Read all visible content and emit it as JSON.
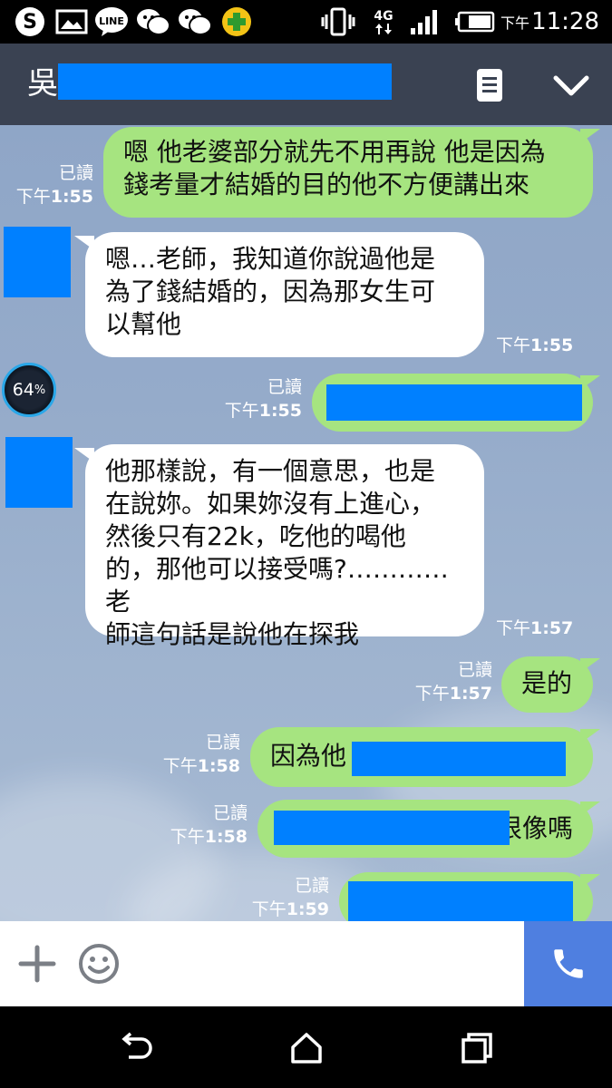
{
  "status_bar": {
    "network": "4G",
    "time_prefix": "下午",
    "time": "11:28",
    "icons": [
      "skype-icon",
      "gallery-icon",
      "line-icon",
      "wechat-icon",
      "wechat-icon",
      "plus-app-icon",
      "vibrate-icon",
      "signal-icon",
      "battery-icon"
    ]
  },
  "header": {
    "contact_name": "吳"
  },
  "messages": [
    {
      "dir": "out",
      "text": "嗯 他老婆部分就先不用再說 他是因為\n錢考量才結婚的目的他不方便講出來",
      "read": "已讀",
      "time_prefix": "下午",
      "time": "1:55"
    },
    {
      "dir": "in",
      "text": "嗯…老師，我知道你說過他是\n為了錢結婚的，因為那女生可\n以幫他",
      "time_prefix": "下午",
      "time": "1:55"
    },
    {
      "dir": "out",
      "text": "",
      "read": "已讀",
      "time_prefix": "下午",
      "time": "1:55"
    },
    {
      "dir": "in",
      "text": "他那樣說，有一個意思，也是\n在說妳。如果妳沒有上進心，\n然後只有22k，吃他的喝他\n的，那他可以接受嗎?…………老\n師這句話是說他在探我",
      "time_prefix": "下午",
      "time": "1:57"
    },
    {
      "dir": "out",
      "text": "是的",
      "read": "已讀",
      "time_prefix": "下午",
      "time": "1:57"
    },
    {
      "dir": "out",
      "text": "因為他",
      "read": "已讀",
      "time_prefix": "下午",
      "time": "1:58"
    },
    {
      "dir": "out",
      "text": "很像嗎",
      "read": "已讀",
      "time_prefix": "下午",
      "time": "1:58"
    },
    {
      "dir": "out",
      "text": "",
      "read": "已讀",
      "time_prefix": "下午",
      "time": "1:59"
    }
  ],
  "overlay_badge": {
    "value": "64",
    "unit": "%"
  },
  "input_bar": {
    "plus": "plus-icon",
    "emoji": "emoji-icon",
    "call": "phone-icon"
  },
  "nav_bar": {
    "buttons": [
      "back-icon",
      "home-icon",
      "recents-icon"
    ]
  },
  "colors": {
    "header": "#3a4252",
    "outgoing_bubble": "#a6e480",
    "incoming_bubble": "#ffffff",
    "redaction": "#0080ff",
    "call_button": "#4f7fe0"
  }
}
